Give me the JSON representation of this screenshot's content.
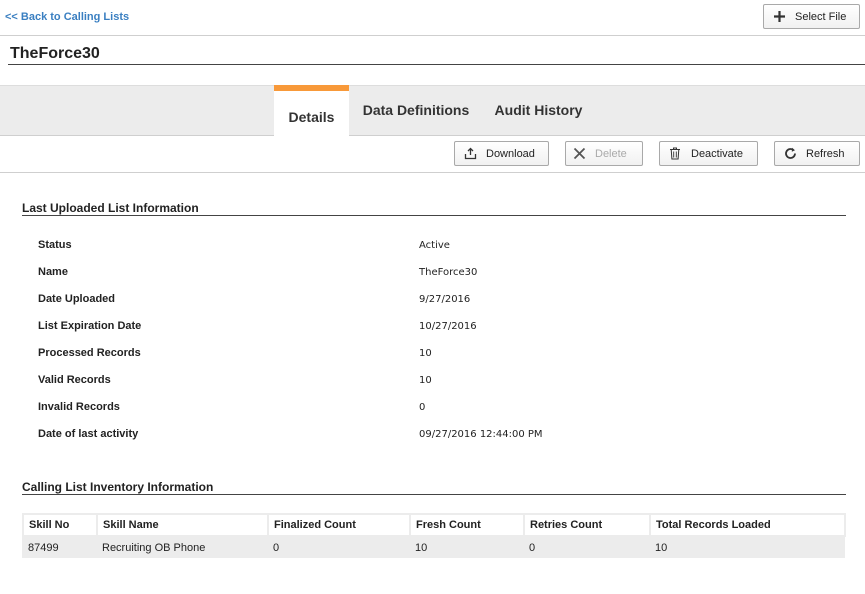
{
  "nav": {
    "back_label": "<< Back to Calling Lists"
  },
  "header": {
    "select_file_label": "Select File",
    "list_title": "TheForce30"
  },
  "tabs": [
    {
      "label": "Details",
      "active": true
    },
    {
      "label": "Data Definitions",
      "active": false
    },
    {
      "label": "Audit History",
      "active": false
    }
  ],
  "actions": {
    "download_label": "Download",
    "delete_label": "Delete",
    "deactivate_label": "Deactivate",
    "refresh_label": "Refresh"
  },
  "upload_info": {
    "section_title": "Last Uploaded List Information",
    "rows": [
      {
        "label": "Status",
        "value": "Active"
      },
      {
        "label": "Name",
        "value": "TheForce30"
      },
      {
        "label": "Date Uploaded",
        "value": "9/27/2016"
      },
      {
        "label": "List Expiration Date",
        "value": "10/27/2016"
      },
      {
        "label": "Processed Records",
        "value": "10"
      },
      {
        "label": "Valid Records",
        "value": "10"
      },
      {
        "label": "Invalid Records",
        "value": "0"
      },
      {
        "label": "Date of last activity",
        "value": "09/27/2016 12:44:00 PM"
      }
    ]
  },
  "inventory": {
    "section_title": "Calling List Inventory Information",
    "columns": [
      "Skill No",
      "Skill Name",
      "Finalized Count",
      "Fresh Count",
      "Retries Count",
      "Total Records Loaded"
    ],
    "rows": [
      [
        "87499",
        "Recruiting OB Phone",
        "0",
        "10",
        "0",
        "10"
      ]
    ]
  },
  "colors": {
    "accent": "#f89939",
    "link": "#3a7fc1",
    "tabbar_bg": "#ececec"
  },
  "icons": {
    "select_file": "plus-icon",
    "download": "upload-box-icon",
    "delete": "x-icon",
    "deactivate": "trash-icon",
    "refresh": "refresh-icon"
  }
}
